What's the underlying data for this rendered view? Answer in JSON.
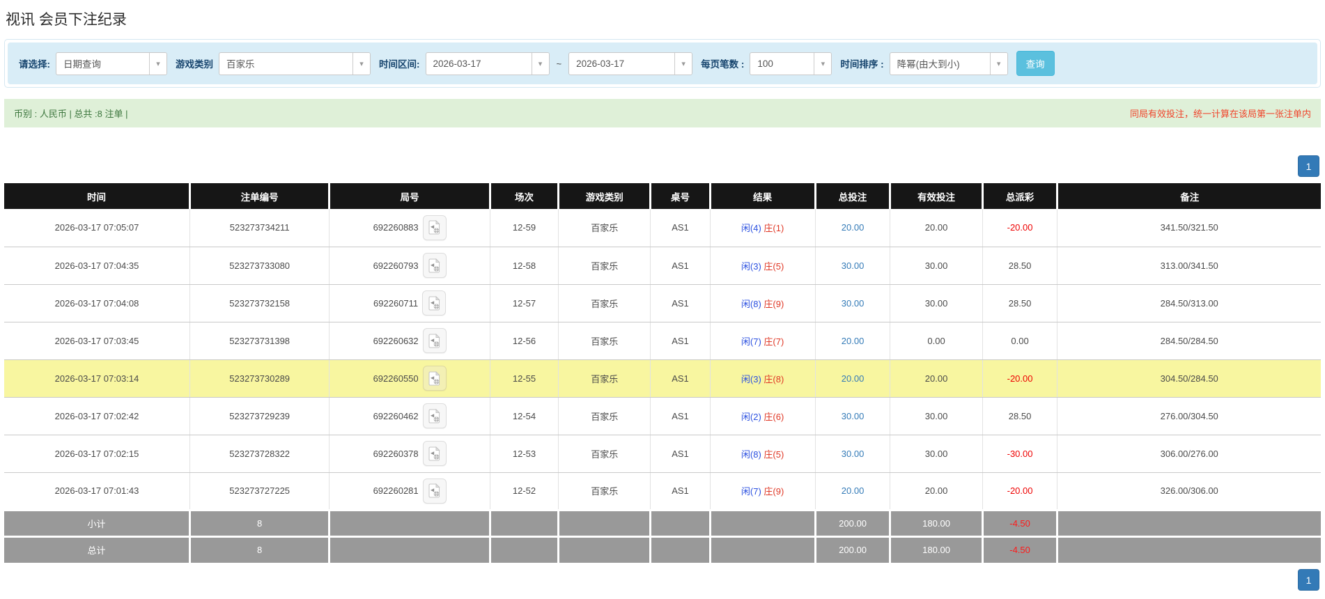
{
  "page_title": "视讯 会员下注纪录",
  "icons": {
    "dropdown_arrow": "▾"
  },
  "filters": {
    "query_type_label": "请选择:",
    "query_type_value": "日期查询",
    "game_type_label": "游戏类别",
    "game_type_value": "百家乐",
    "time_range_label": "时间区间:",
    "date_from": "2026-03-17",
    "range_separator": "~",
    "date_to": "2026-03-17",
    "page_size_label": "每页笔数 :",
    "page_size_value": "100",
    "sort_label": "时间排序 :",
    "sort_value": "降幂(由大到小)",
    "search_button": "查询"
  },
  "summary_bar": {
    "left_text": "币别 : 人民币 | 总共 :8 注单 |",
    "right_text": "同局有效投注，统一计算在该局第一张注单内"
  },
  "pagination": {
    "page": "1"
  },
  "table": {
    "headers": [
      "时间",
      "注单编号",
      "局号",
      "场次",
      "游戏类别",
      "桌号",
      "结果",
      "总投注",
      "有效投注",
      "总派彩",
      "备注"
    ],
    "rows": [
      {
        "time": "2026-03-17 07:05:07",
        "bet_id": "523273734211",
        "round_id": "692260883",
        "session": "12-59",
        "game_type": "百家乐",
        "table_no": "AS1",
        "result_player": "闲(4)",
        "result_banker": "庄(1)",
        "total_bet": "20.00",
        "valid_bet": "20.00",
        "payout": "-20.00",
        "remark": "341.50/321.50",
        "highlighted": false
      },
      {
        "time": "2026-03-17 07:04:35",
        "bet_id": "523273733080",
        "round_id": "692260793",
        "session": "12-58",
        "game_type": "百家乐",
        "table_no": "AS1",
        "result_player": "闲(3)",
        "result_banker": "庄(5)",
        "total_bet": "30.00",
        "valid_bet": "30.00",
        "payout": "28.50",
        "remark": "313.00/341.50",
        "highlighted": false
      },
      {
        "time": "2026-03-17 07:04:08",
        "bet_id": "523273732158",
        "round_id": "692260711",
        "session": "12-57",
        "game_type": "百家乐",
        "table_no": "AS1",
        "result_player": "闲(8)",
        "result_banker": "庄(9)",
        "total_bet": "30.00",
        "valid_bet": "30.00",
        "payout": "28.50",
        "remark": "284.50/313.00",
        "highlighted": false
      },
      {
        "time": "2026-03-17 07:03:45",
        "bet_id": "523273731398",
        "round_id": "692260632",
        "session": "12-56",
        "game_type": "百家乐",
        "table_no": "AS1",
        "result_player": "闲(7)",
        "result_banker": "庄(7)",
        "total_bet": "20.00",
        "valid_bet": "0.00",
        "payout": "0.00",
        "remark": "284.50/284.50",
        "highlighted": false
      },
      {
        "time": "2026-03-17 07:03:14",
        "bet_id": "523273730289",
        "round_id": "692260550",
        "session": "12-55",
        "game_type": "百家乐",
        "table_no": "AS1",
        "result_player": "闲(3)",
        "result_banker": "庄(8)",
        "total_bet": "20.00",
        "valid_bet": "20.00",
        "payout": "-20.00",
        "remark": "304.50/284.50",
        "highlighted": true
      },
      {
        "time": "2026-03-17 07:02:42",
        "bet_id": "523273729239",
        "round_id": "692260462",
        "session": "12-54",
        "game_type": "百家乐",
        "table_no": "AS1",
        "result_player": "闲(2)",
        "result_banker": "庄(6)",
        "total_bet": "30.00",
        "valid_bet": "30.00",
        "payout": "28.50",
        "remark": "276.00/304.50",
        "highlighted": false
      },
      {
        "time": "2026-03-17 07:02:15",
        "bet_id": "523273728322",
        "round_id": "692260378",
        "session": "12-53",
        "game_type": "百家乐",
        "table_no": "AS1",
        "result_player": "闲(8)",
        "result_banker": "庄(5)",
        "total_bet": "30.00",
        "valid_bet": "30.00",
        "payout": "-30.00",
        "remark": "306.00/276.00",
        "highlighted": false
      },
      {
        "time": "2026-03-17 07:01:43",
        "bet_id": "523273727225",
        "round_id": "692260281",
        "session": "12-52",
        "game_type": "百家乐",
        "table_no": "AS1",
        "result_player": "闲(7)",
        "result_banker": "庄(9)",
        "total_bet": "20.00",
        "valid_bet": "20.00",
        "payout": "-20.00",
        "remark": "326.00/306.00",
        "highlighted": false
      }
    ],
    "subtotal": {
      "label": "小计",
      "count": "8",
      "total_bet": "200.00",
      "valid_bet": "180.00",
      "payout": "-4.50"
    },
    "total": {
      "label": "总计",
      "count": "8",
      "total_bet": "200.00",
      "valid_bet": "180.00",
      "payout": "-4.50"
    }
  }
}
